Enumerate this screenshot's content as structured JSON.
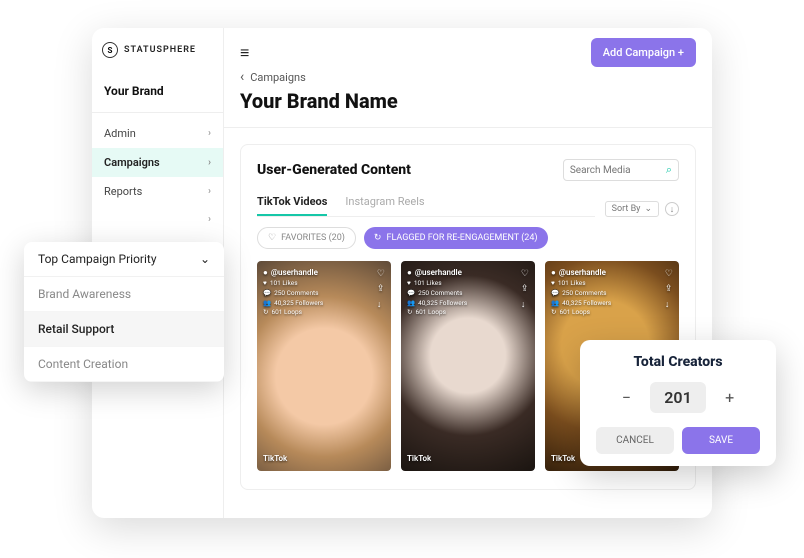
{
  "logo": {
    "mark": "S",
    "text": "STATUSPHERE"
  },
  "sidebar": {
    "brand_title": "Your Brand",
    "items": [
      {
        "label": "Admin"
      },
      {
        "label": "Campaigns"
      },
      {
        "label": "Reports"
      }
    ]
  },
  "header": {
    "breadcrumb": "Campaigns",
    "title": "Your Brand Name",
    "add_button": "Add Campaign  +"
  },
  "panel": {
    "title": "User-Generated Content",
    "search_placeholder": "Search Media",
    "tabs": [
      {
        "label": "TikTok Videos"
      },
      {
        "label": "Instagram Reels"
      }
    ],
    "sort_label": "Sort By",
    "chips": {
      "favorites": "FAVORITES (20)",
      "flagged": "FLAGGED FOR RE-ENGAGEMENT (24)"
    },
    "thumbs": [
      {
        "handle": "@userhandle",
        "likes": "101 Likes",
        "comments": "250 Comments",
        "followers": "40,325 Followers",
        "loops": "601 Loops",
        "brand": "TikTok"
      },
      {
        "handle": "@userhandle",
        "likes": "101 Likes",
        "comments": "250 Comments",
        "followers": "40,325 Followers",
        "loops": "601 Loops",
        "brand": "TikTok"
      },
      {
        "handle": "@userhandle",
        "likes": "101 Likes",
        "comments": "250 Comments",
        "followers": "40,325 Followers",
        "loops": "601 Loops",
        "brand": "TikTok"
      }
    ]
  },
  "dropdown": {
    "title": "Top Campaign Priority",
    "items": [
      {
        "label": "Brand Awareness"
      },
      {
        "label": "Retail Support"
      },
      {
        "label": "Content Creation"
      }
    ]
  },
  "counter": {
    "title": "Total Creators",
    "value": "201",
    "cancel": "CANCEL",
    "save": "SAVE"
  },
  "colors": {
    "accent_teal": "#16c7a8",
    "accent_purple": "#8b74ea"
  }
}
